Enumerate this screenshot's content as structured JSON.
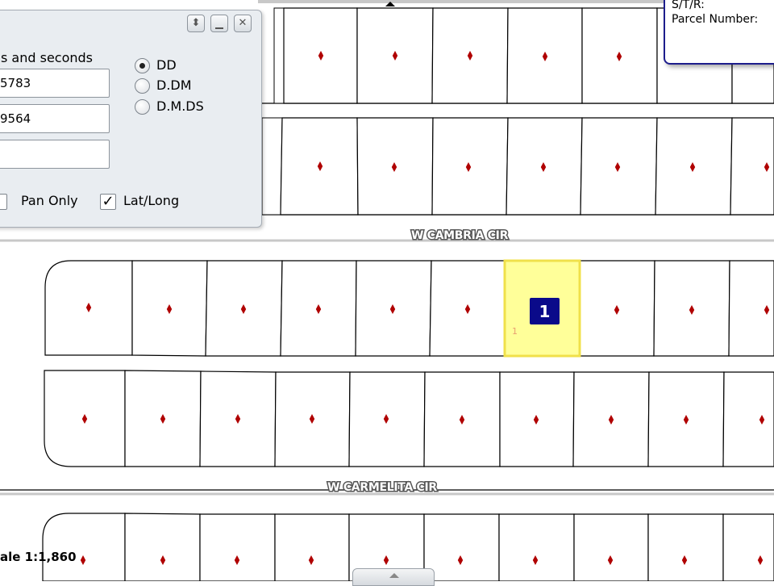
{
  "info_panel": {
    "line1": "S/T/R:",
    "line2": "Parcel Number:"
  },
  "coord_dialog": {
    "format_label": "s and seconds",
    "inputs": [
      {
        "value": "5783"
      },
      {
        "value": "9564"
      },
      {
        "value": ""
      }
    ],
    "radio_options": [
      {
        "label": "DD",
        "checked": true
      },
      {
        "label": "D.DM",
        "checked": false
      },
      {
        "label": "D.M.DS",
        "checked": false
      }
    ],
    "pan_only_label": "Pan Only",
    "pan_only_checked": false,
    "latlong_label": "Lat/Long",
    "latlong_checked": true,
    "check_glyph": "✓"
  },
  "streets": [
    {
      "name": "W CAMBRIA CIR"
    },
    {
      "name": "W CARMELITA CIR"
    }
  ],
  "selected_parcel": {
    "marker_label": "1",
    "lot_number": "1",
    "highlight_color": "#ffff99",
    "outline_color": "#f0e04a",
    "marker_color": "#0a0a8a"
  },
  "parcel_point_color": "#b00000",
  "scale_text": "ale 1:1,860",
  "icons": {
    "restore": "restore-icon",
    "minimize": "minimize-icon",
    "close": "close-icon"
  }
}
